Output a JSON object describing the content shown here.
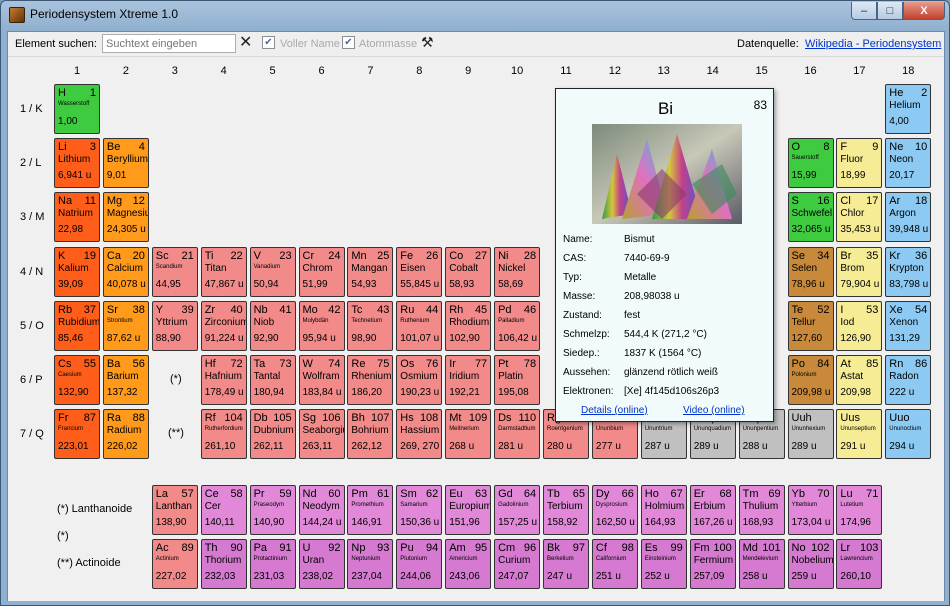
{
  "window": {
    "title": "Periodensystem Xtreme 1.0",
    "minimize": "–",
    "maximize": "□",
    "close": "X"
  },
  "toolbar": {
    "search_label": "Element suchen:",
    "search_placeholder": "Suchtext eingeben",
    "full_name_label": "Voller Name",
    "atomic_mass_label": "Atommasse",
    "source_label": "Datenquelle:",
    "source_link": "Wikipedia - Periodensystem"
  },
  "groups": [
    "1",
    "2",
    "3",
    "4",
    "5",
    "6",
    "7",
    "8",
    "9",
    "10",
    "11",
    "12",
    "13",
    "14",
    "15",
    "16",
    "17",
    "18"
  ],
  "periods": [
    "1 / K",
    "2 / L",
    "3 / M",
    "4 / N",
    "5 / O",
    "6 / P",
    "7 / Q"
  ],
  "placeholders": {
    "lanthanide_ref": "(*)",
    "actinide_ref": "(**)"
  },
  "series_labels": {
    "lanthanoids": "(*) Lanthanoide",
    "actinoids": "(**) Actinoide"
  },
  "colors": {
    "alkali": "#ff6a1a",
    "alkaline_earth": "#ff9a1a",
    "transition": "#f29090",
    "nonmetal": "#40d040",
    "halogen": "#f6ec96",
    "noble": "#8ccaf3",
    "metalloid": "#c8a03c",
    "post_transition": "#b8b8b8",
    "unknown": "#c8c8c8",
    "lanthanoid": "#f28fa6",
    "actinoid": "#e085dc"
  },
  "elements": [
    {
      "s": "H",
      "n": "1",
      "name": "Wasserstoff",
      "m": "1,00",
      "c": "#3fcb3f",
      "g": 1,
      "p": 1,
      "sm": true
    },
    {
      "s": "He",
      "n": "2",
      "name": "Helium",
      "m": "4,00",
      "c": "#8ccaf3",
      "g": 18,
      "p": 1
    },
    {
      "s": "Li",
      "n": "3",
      "name": "Lithium",
      "m": "6,941 u",
      "c": "#ff5d1a",
      "g": 1,
      "p": 2
    },
    {
      "s": "Be",
      "n": "4",
      "name": "Beryllium",
      "m": "9,01",
      "c": "#ff9a1a",
      "g": 2,
      "p": 2
    },
    {
      "s": "O",
      "n": "8",
      "name": "Sauerstoff",
      "m": "15,99",
      "c": "#3fcb3f",
      "g": 16,
      "p": 2,
      "sm": true
    },
    {
      "s": "F",
      "n": "9",
      "name": "Fluor",
      "m": "18,99",
      "c": "#f6ec96",
      "g": 17,
      "p": 2
    },
    {
      "s": "Ne",
      "n": "10",
      "name": "Neon",
      "m": "20,17",
      "c": "#8ccaf3",
      "g": 18,
      "p": 2
    },
    {
      "s": "Na",
      "n": "11",
      "name": "Natrium",
      "m": "22,98",
      "c": "#ff5d1a",
      "g": 1,
      "p": 3
    },
    {
      "s": "Mg",
      "n": "12",
      "name": "Magnesium",
      "m": "24,305 u",
      "c": "#ff9a1a",
      "g": 2,
      "p": 3
    },
    {
      "s": "S",
      "n": "16",
      "name": "Schwefel",
      "m": "32,065 u",
      "c": "#3fcb3f",
      "g": 16,
      "p": 3
    },
    {
      "s": "Cl",
      "n": "17",
      "name": "Chlor",
      "m": "35,453 u",
      "c": "#f6ec96",
      "g": 17,
      "p": 3
    },
    {
      "s": "Ar",
      "n": "18",
      "name": "Argon",
      "m": "39,948 u",
      "c": "#8ccaf3",
      "g": 18,
      "p": 3
    },
    {
      "s": "K",
      "n": "19",
      "name": "Kalium",
      "m": "39,09",
      "c": "#ff5d1a",
      "g": 1,
      "p": 4
    },
    {
      "s": "Ca",
      "n": "20",
      "name": "Calcium",
      "m": "40,078 u",
      "c": "#ff9a1a",
      "g": 2,
      "p": 4
    },
    {
      "s": "Sc",
      "n": "21",
      "name": "Scandium",
      "m": "44,95",
      "c": "#f28a8a",
      "g": 3,
      "p": 4,
      "sm": true
    },
    {
      "s": "Ti",
      "n": "22",
      "name": "Titan",
      "m": "47,867 u",
      "c": "#f28a8a",
      "g": 4,
      "p": 4
    },
    {
      "s": "V",
      "n": "23",
      "name": "Vanadium",
      "m": "50,94",
      "c": "#f28a8a",
      "g": 5,
      "p": 4,
      "sm": true
    },
    {
      "s": "Cr",
      "n": "24",
      "name": "Chrom",
      "m": "51,99",
      "c": "#f28a8a",
      "g": 6,
      "p": 4
    },
    {
      "s": "Mn",
      "n": "25",
      "name": "Mangan",
      "m": "54,93",
      "c": "#f28a8a",
      "g": 7,
      "p": 4
    },
    {
      "s": "Fe",
      "n": "26",
      "name": "Eisen",
      "m": "55,845 u",
      "c": "#f28a8a",
      "g": 8,
      "p": 4
    },
    {
      "s": "Co",
      "n": "27",
      "name": "Cobalt",
      "m": "58,93",
      "c": "#f28a8a",
      "g": 9,
      "p": 4
    },
    {
      "s": "Ni",
      "n": "28",
      "name": "Nickel",
      "m": "58,69",
      "c": "#f28a8a",
      "g": 10,
      "p": 4
    },
    {
      "s": "Se",
      "n": "34",
      "name": "Selen",
      "m": "78,96 u",
      "c": "#c8893a",
      "g": 16,
      "p": 4
    },
    {
      "s": "Br",
      "n": "35",
      "name": "Brom",
      "m": "79,904 u",
      "c": "#f6ec96",
      "g": 17,
      "p": 4
    },
    {
      "s": "Kr",
      "n": "36",
      "name": "Krypton",
      "m": "83,798 u",
      "c": "#8ccaf3",
      "g": 18,
      "p": 4
    },
    {
      "s": "Rb",
      "n": "37",
      "name": "Rubidium",
      "m": "85,46",
      "c": "#ff5d1a",
      "g": 1,
      "p": 5
    },
    {
      "s": "Sr",
      "n": "38",
      "name": "Strontium",
      "m": "87,62 u",
      "c": "#ff9a1a",
      "g": 2,
      "p": 5,
      "sm": true
    },
    {
      "s": "Y",
      "n": "39",
      "name": "Yttrium",
      "m": "88,90",
      "c": "#f28a8a",
      "g": 3,
      "p": 5
    },
    {
      "s": "Zr",
      "n": "40",
      "name": "Zirconium",
      "m": "91,224 u",
      "c": "#f28a8a",
      "g": 4,
      "p": 5
    },
    {
      "s": "Nb",
      "n": "41",
      "name": "Niob",
      "m": "92,90",
      "c": "#f28a8a",
      "g": 5,
      "p": 5
    },
    {
      "s": "Mo",
      "n": "42",
      "name": "Molybdän",
      "m": "95,94 u",
      "c": "#f28a8a",
      "g": 6,
      "p": 5,
      "sm": true
    },
    {
      "s": "Tc",
      "n": "43",
      "name": "Technetium",
      "m": "98,90",
      "c": "#f28a8a",
      "g": 7,
      "p": 5,
      "sm": true
    },
    {
      "s": "Ru",
      "n": "44",
      "name": "Ruthenium",
      "m": "101,07 u",
      "c": "#f28a8a",
      "g": 8,
      "p": 5,
      "sm": true
    },
    {
      "s": "Rh",
      "n": "45",
      "name": "Rhodium",
      "m": "102,90",
      "c": "#f28a8a",
      "g": 9,
      "p": 5
    },
    {
      "s": "Pd",
      "n": "46",
      "name": "Palladium",
      "m": "106,42 u",
      "c": "#f28a8a",
      "g": 10,
      "p": 5,
      "sm": true
    },
    {
      "s": "Te",
      "n": "52",
      "name": "Tellur",
      "m": "127,60",
      "c": "#c8893a",
      "g": 16,
      "p": 5
    },
    {
      "s": "I",
      "n": "53",
      "name": "Iod",
      "m": "126,90",
      "c": "#f6ec96",
      "g": 17,
      "p": 5
    },
    {
      "s": "Xe",
      "n": "54",
      "name": "Xenon",
      "m": "131,29",
      "c": "#8ccaf3",
      "g": 18,
      "p": 5
    },
    {
      "s": "Cs",
      "n": "55",
      "name": "Caesium",
      "m": "132,90",
      "c": "#ff5d1a",
      "g": 1,
      "p": 6,
      "sm": true
    },
    {
      "s": "Ba",
      "n": "56",
      "name": "Barium",
      "m": "137,32",
      "c": "#ff9a1a",
      "g": 2,
      "p": 6
    },
    {
      "s": "Hf",
      "n": "72",
      "name": "Hafnium",
      "m": "178,49 u",
      "c": "#f28a8a",
      "g": 4,
      "p": 6
    },
    {
      "s": "Ta",
      "n": "73",
      "name": "Tantal",
      "m": "180,94",
      "c": "#f28a8a",
      "g": 5,
      "p": 6
    },
    {
      "s": "W",
      "n": "74",
      "name": "Wolfram",
      "m": "183,84 u",
      "c": "#f28a8a",
      "g": 6,
      "p": 6
    },
    {
      "s": "Re",
      "n": "75",
      "name": "Rhenium",
      "m": "186,20",
      "c": "#f28a8a",
      "g": 7,
      "p": 6
    },
    {
      "s": "Os",
      "n": "76",
      "name": "Osmium",
      "m": "190,23 u",
      "c": "#f28a8a",
      "g": 8,
      "p": 6
    },
    {
      "s": "Ir",
      "n": "77",
      "name": "Iridium",
      "m": "192,21",
      "c": "#f28a8a",
      "g": 9,
      "p": 6
    },
    {
      "s": "Pt",
      "n": "78",
      "name": "Platin",
      "m": "195,08",
      "c": "#f28a8a",
      "g": 10,
      "p": 6
    },
    {
      "s": "Po",
      "n": "84",
      "name": "Polonium",
      "m": "209,98 u",
      "c": "#c8893a",
      "g": 16,
      "p": 6,
      "sm": true
    },
    {
      "s": "At",
      "n": "85",
      "name": "Astat",
      "m": "209,98",
      "c": "#f6ec96",
      "g": 17,
      "p": 6
    },
    {
      "s": "Rn",
      "n": "86",
      "name": "Radon",
      "m": "222 u",
      "c": "#8ccaf3",
      "g": 18,
      "p": 6
    },
    {
      "s": "Fr",
      "n": "87",
      "name": "Francium",
      "m": "223,01",
      "c": "#ff5d1a",
      "g": 1,
      "p": 7,
      "sm": true
    },
    {
      "s": "Ra",
      "n": "88",
      "name": "Radium",
      "m": "226,02",
      "c": "#ff9a1a",
      "g": 2,
      "p": 7
    },
    {
      "s": "Rf",
      "n": "104",
      "name": "Rutherfordium",
      "m": "261,10",
      "c": "#f28a8a",
      "g": 4,
      "p": 7,
      "sm": true
    },
    {
      "s": "Db",
      "n": "105",
      "name": "Dubnium",
      "m": "262,11",
      "c": "#f28a8a",
      "g": 5,
      "p": 7
    },
    {
      "s": "Sg",
      "n": "106",
      "name": "Seaborgium",
      "m": "263,11",
      "c": "#f28a8a",
      "g": 6,
      "p": 7
    },
    {
      "s": "Bh",
      "n": "107",
      "name": "Bohrium",
      "m": "262,12",
      "c": "#f28a8a",
      "g": 7,
      "p": 7
    },
    {
      "s": "Hs",
      "n": "108",
      "name": "Hassium",
      "m": "269, 270",
      "c": "#f28a8a",
      "g": 8,
      "p": 7
    },
    {
      "s": "Mt",
      "n": "109",
      "name": "Meitnerium",
      "m": "268 u",
      "c": "#f28a8a",
      "g": 9,
      "p": 7,
      "sm": true
    },
    {
      "s": "Ds",
      "n": "110",
      "name": "Darmstadtium",
      "m": "281 u",
      "c": "#f28a8a",
      "g": 10,
      "p": 7,
      "sm": true
    },
    {
      "s": "Rg",
      "n": "111",
      "name": "Roentgenium",
      "m": "280 u",
      "c": "#f28a8a",
      "g": 11,
      "p": 7,
      "sm": true
    },
    {
      "s": "Uub",
      "n": "",
      "name": "Ununbium",
      "m": "277 u",
      "c": "#f28a8a",
      "g": 12,
      "p": 7,
      "sm": true
    },
    {
      "s": "Uut",
      "n": "",
      "name": "Ununtrium",
      "m": "287 u",
      "c": "#c0c0c0",
      "g": 13,
      "p": 7,
      "sm": true
    },
    {
      "s": "Uuq",
      "n": "",
      "name": "Ununquadium",
      "m": "289 u",
      "c": "#c0c0c0",
      "g": 14,
      "p": 7,
      "sm": true
    },
    {
      "s": "Uup",
      "n": "",
      "name": "Ununpentium",
      "m": "288 u",
      "c": "#c0c0c0",
      "g": 15,
      "p": 7,
      "sm": true
    },
    {
      "s": "Uuh",
      "n": "",
      "name": "Ununhexium",
      "m": "289 u",
      "c": "#c0c0c0",
      "g": 16,
      "p": 7,
      "sm": true
    },
    {
      "s": "Uus",
      "n": "",
      "name": "Ununseptium",
      "m": "291 u",
      "c": "#f6ec96",
      "g": 17,
      "p": 7,
      "sm": true
    },
    {
      "s": "Uuo",
      "n": "",
      "name": "Ununoctium",
      "m": "294 u",
      "c": "#8ccaf3",
      "g": 18,
      "p": 7,
      "sm": true
    }
  ],
  "lanthanoids": [
    {
      "s": "La",
      "n": "57",
      "name": "Lanthan",
      "m": "138,90",
      "c": "#f28a8a"
    },
    {
      "s": "Ce",
      "n": "58",
      "name": "Cer",
      "m": "140,11",
      "c": "#e189d8"
    },
    {
      "s": "Pr",
      "n": "59",
      "name": "Praseodym",
      "m": "140,90",
      "c": "#e189d8",
      "sm": true
    },
    {
      "s": "Nd",
      "n": "60",
      "name": "Neodym",
      "m": "144,24 u",
      "c": "#e189d8"
    },
    {
      "s": "Pm",
      "n": "61",
      "name": "Promethium",
      "m": "146,91",
      "c": "#e189d8",
      "sm": true
    },
    {
      "s": "Sm",
      "n": "62",
      "name": "Samarium",
      "m": "150,36 u",
      "c": "#e189d8",
      "sm": true
    },
    {
      "s": "Eu",
      "n": "63",
      "name": "Europium",
      "m": "151,96",
      "c": "#e189d8"
    },
    {
      "s": "Gd",
      "n": "64",
      "name": "Gadolinium",
      "m": "157,25 u",
      "c": "#e189d8",
      "sm": true
    },
    {
      "s": "Tb",
      "n": "65",
      "name": "Terbium",
      "m": "158,92",
      "c": "#e189d8"
    },
    {
      "s": "Dy",
      "n": "66",
      "name": "Dysprosium",
      "m": "162,50 u",
      "c": "#e189d8",
      "sm": true
    },
    {
      "s": "Ho",
      "n": "67",
      "name": "Holmium",
      "m": "164,93",
      "c": "#e189d8"
    },
    {
      "s": "Er",
      "n": "68",
      "name": "Erbium",
      "m": "167,26 u",
      "c": "#e189d8"
    },
    {
      "s": "Tm",
      "n": "69",
      "name": "Thulium",
      "m": "168,93",
      "c": "#e189d8"
    },
    {
      "s": "Yb",
      "n": "70",
      "name": "Ytterbium",
      "m": "173,04 u",
      "c": "#e189d8",
      "sm": true
    },
    {
      "s": "Lu",
      "n": "71",
      "name": "Lutetium",
      "m": "174,96",
      "c": "#e189d8",
      "sm": true
    }
  ],
  "actinoids": [
    {
      "s": "Ac",
      "n": "89",
      "name": "Actinium",
      "m": "227,02",
      "c": "#f28a8a",
      "sm": true
    },
    {
      "s": "Th",
      "n": "90",
      "name": "Thorium",
      "m": "232,03",
      "c": "#d57ad0"
    },
    {
      "s": "Pa",
      "n": "91",
      "name": "Protactinium",
      "m": "231,03",
      "c": "#d57ad0",
      "sm": true
    },
    {
      "s": "U",
      "n": "92",
      "name": "Uran",
      "m": "238,02",
      "c": "#d57ad0"
    },
    {
      "s": "Np",
      "n": "93",
      "name": "Neptunium",
      "m": "237,04",
      "c": "#d57ad0",
      "sm": true
    },
    {
      "s": "Pu",
      "n": "94",
      "name": "Plutonium",
      "m": "244,06",
      "c": "#d57ad0",
      "sm": true
    },
    {
      "s": "Am",
      "n": "95",
      "name": "Americium",
      "m": "243,06",
      "c": "#d57ad0",
      "sm": true
    },
    {
      "s": "Cm",
      "n": "96",
      "name": "Curium",
      "m": "247,07",
      "c": "#d57ad0"
    },
    {
      "s": "Bk",
      "n": "97",
      "name": "Berkelium",
      "m": "247 u",
      "c": "#d57ad0",
      "sm": true
    },
    {
      "s": "Cf",
      "n": "98",
      "name": "Californium",
      "m": "251 u",
      "c": "#d57ad0",
      "sm": true
    },
    {
      "s": "Es",
      "n": "99",
      "name": "Einsteinium",
      "m": "252 u",
      "c": "#d57ad0",
      "sm": true
    },
    {
      "s": "Fm",
      "n": "100",
      "name": "Fermium",
      "m": "257,09",
      "c": "#d57ad0"
    },
    {
      "s": "Md",
      "n": "101",
      "name": "Mendelevium",
      "m": "258 u",
      "c": "#d57ad0",
      "sm": true
    },
    {
      "s": "No",
      "n": "102",
      "name": "Nobelium",
      "m": "259 u",
      "c": "#d57ad0"
    },
    {
      "s": "Lr",
      "n": "103",
      "name": "Lawrencium",
      "m": "260,10",
      "c": "#d57ad0",
      "sm": true
    }
  ],
  "popup": {
    "symbol": "Bi",
    "number": "83",
    "props": [
      {
        "k": "Name:",
        "v": "Bismut"
      },
      {
        "k": "CAS:",
        "v": "7440-69-9"
      },
      {
        "k": "Typ:",
        "v": "Metalle"
      },
      {
        "k": "Masse:",
        "v": "208,98038 u"
      },
      {
        "k": "Zustand:",
        "v": "fest"
      },
      {
        "k": "Schmelzp:",
        "v": "544,4 K (271,2 °C)"
      },
      {
        "k": "Siedep.:",
        "v": "1837 K (1564 °C)"
      },
      {
        "k": "Aussehen:",
        "v": "glänzend rötlich weiß"
      },
      {
        "k": "Elektronen:",
        "v": "[Xe] 4f145d106s26p3"
      }
    ],
    "details_link": "Details (online)",
    "video_link": "Video (online)"
  }
}
